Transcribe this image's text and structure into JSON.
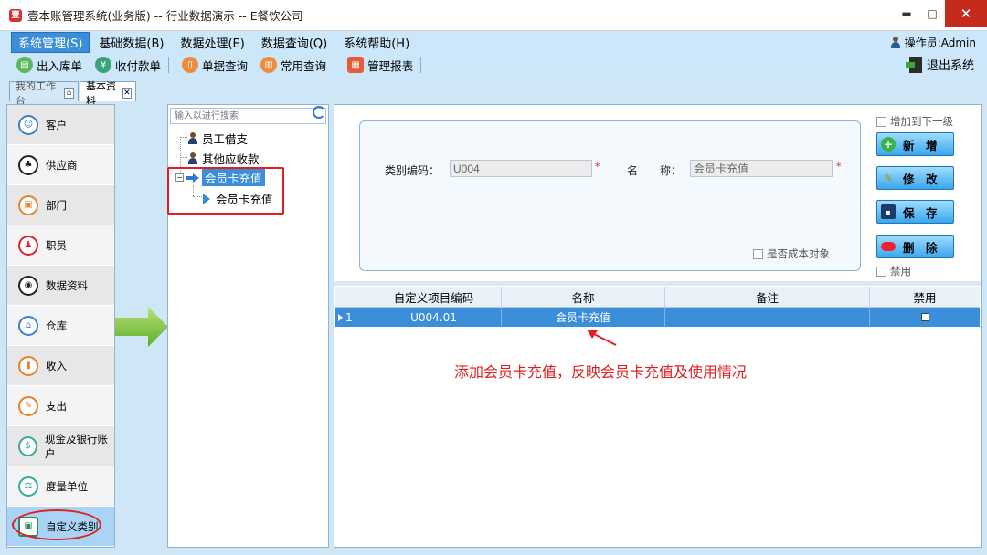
{
  "window": {
    "title": "壹本账管理系统(业务版) -- 行业数据演示 -- E餐饮公司",
    "minimize": "▬",
    "maximize": "□",
    "close": "✕"
  },
  "menu": {
    "items": [
      "系统管理(S)",
      "基础数据(B)",
      "数据处理(E)",
      "数据查询(Q)",
      "系统帮助(H)"
    ],
    "operator": "操作员:Admin"
  },
  "toolbar": {
    "buttons": [
      "出入库单",
      "收付款单",
      "单据查询",
      "常用查询",
      "管理报表"
    ],
    "exit": "退出系统"
  },
  "tabs": [
    "我的工作台",
    "基本资料"
  ],
  "left_nav": {
    "items": [
      "客户",
      "供应商",
      "部门",
      "职员",
      "数据资料",
      "仓库",
      "收入",
      "支出",
      "现金及银行账户",
      "度量单位",
      "自定义类别"
    ],
    "selected": "自定义类别"
  },
  "tree": {
    "search_placeholder": "输入以进行搜索",
    "nodes": [
      "员工借支",
      "其他应收款",
      "会员卡充值",
      "会员卡充值"
    ]
  },
  "form": {
    "code_label": "类别编码：",
    "code_value": "U004",
    "name_label": "名　　称：",
    "name_value": "会员卡充值",
    "required_mark": "*",
    "cost_object": "是否成本对象",
    "add_next_level": "增加到下一级",
    "disabled": "禁用"
  },
  "actions": {
    "add": "新　增",
    "edit": "修　改",
    "save": "保　存",
    "delete": "删　除"
  },
  "grid": {
    "columns": [
      "自定义项目编码",
      "名称",
      "备注",
      "禁用"
    ],
    "rows": [
      {
        "index": "1",
        "code": "U004.01",
        "name": "会员卡充值",
        "note": "",
        "disabled": false
      }
    ]
  },
  "annotation": "添加会员卡充值，反映会员卡充值及使用情况",
  "colors": {
    "accent": "#3b8ed9",
    "annotation_red": "#e02020"
  }
}
